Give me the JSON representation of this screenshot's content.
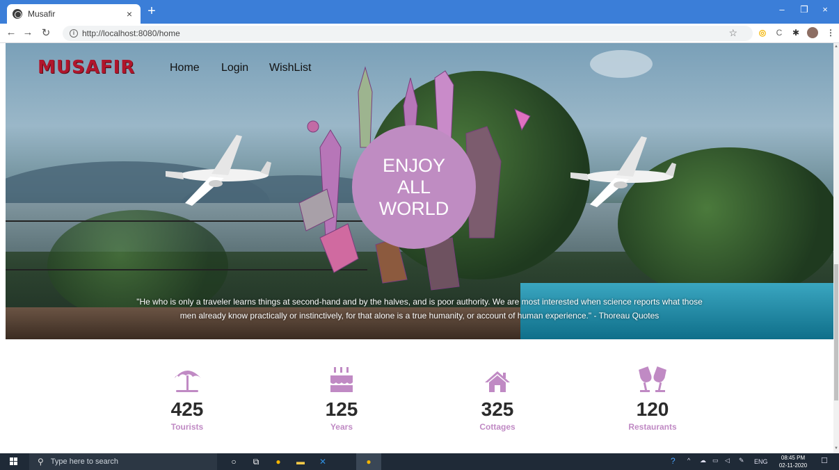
{
  "browser": {
    "tab_title": "Musafir",
    "tab_close": "×",
    "new_tab": "+",
    "url": "http://localhost:8080/home",
    "win_minimize": "–",
    "win_restore": "❐",
    "win_close": "×"
  },
  "site": {
    "logo": "MUSAFIR",
    "nav": [
      "Home",
      "Login",
      "WishList"
    ],
    "hero_circle": [
      "ENJOY",
      "ALL",
      "WORLD"
    ],
    "quote_line1": "\"He who is only a traveler learns things at second-hand and by the halves, and is poor authority. We are most interested when science reports what those",
    "quote_line2": "men already know practically or instinctively, for that alone is a true humanity, or account of human experience.\" - Thoreau Quotes"
  },
  "stats": [
    {
      "value": "425",
      "label": "Tourists",
      "icon": "beach-umbrella-icon"
    },
    {
      "value": "125",
      "label": "Years",
      "icon": "birthday-cake-icon"
    },
    {
      "value": "325",
      "label": "Cottages",
      "icon": "home-icon"
    },
    {
      "value": "120",
      "label": "Restaurants",
      "icon": "wine-glasses-icon"
    }
  ],
  "taskbar": {
    "search_placeholder": "Type here to search",
    "language": "ENG",
    "time": "08:45 PM",
    "date": "02-11-2020"
  },
  "colors": {
    "accent": "#c08ac4",
    "logo": "#b0162c",
    "chrome_blue": "#3b7ed8"
  }
}
